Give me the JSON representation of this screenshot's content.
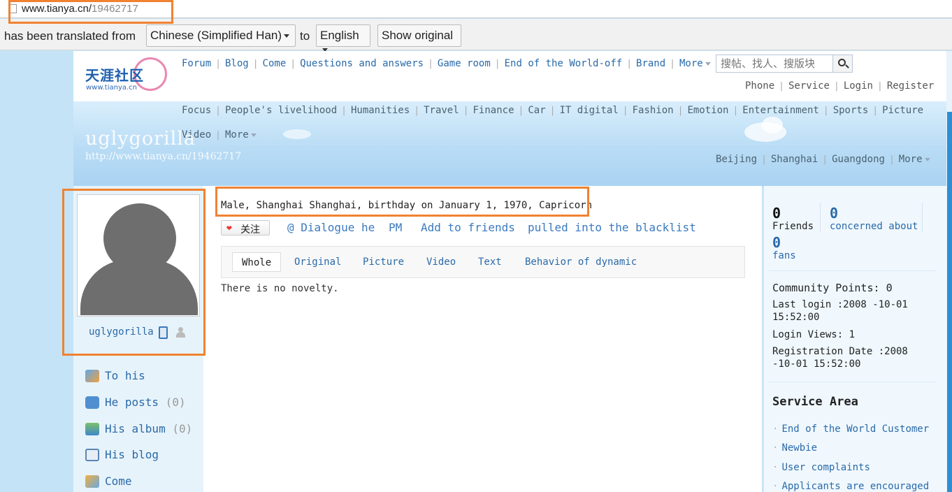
{
  "browser": {
    "url_host": "www.tianya.cn/",
    "url_path": "19462717",
    "translate": {
      "prefix": "has been translated from",
      "from_lang": "Chinese (Simplified Han)",
      "to_word": "to",
      "to_lang": "English",
      "show_original": "Show original"
    }
  },
  "header": {
    "logo_text": "天涯社区",
    "logo_sub": "www.tianya.cn",
    "nav_main": [
      "Forum",
      "Blog",
      "Come",
      "Questions and answers",
      "Game room",
      "End of the World-off",
      "Brand",
      "More"
    ],
    "search_placeholder": "搜帖、找人、搜版块",
    "nav_account": [
      "Phone",
      "Service",
      "Login",
      "Register"
    ],
    "nav_channels_row1": [
      "Focus",
      "People's livelihood",
      "Humanities",
      "Travel",
      "Finance",
      "Car",
      "IT digital",
      "Fashion",
      "Emotion",
      "Entertainment",
      "Sports",
      "Picture"
    ],
    "nav_channels_row2": [
      "Video",
      "More"
    ],
    "nav_cities": [
      "Beijing",
      "Shanghai",
      "Guangdong",
      "More"
    ]
  },
  "blog": {
    "name": "uglygorilla",
    "url": "http://www.tianya.cn/19462717"
  },
  "profile": {
    "username": "uglygorilla",
    "info_line": "Male, Shanghai Shanghai, birthday on January 1, 1970, Capricorn",
    "follow_label": "关注",
    "actions": [
      "@ Dialogue he",
      "PM",
      "Add to friends",
      "pulled into the blacklist"
    ],
    "tabs": [
      "Whole",
      "Original",
      "Picture",
      "Video",
      "Text",
      "Behavior of dynamic"
    ],
    "empty_message": "There is no novelty."
  },
  "left_menu": [
    {
      "label": "To his",
      "count": ""
    },
    {
      "label": "He posts",
      "count": "(0)"
    },
    {
      "label": "His album",
      "count": "(0)"
    },
    {
      "label": "His blog",
      "count": ""
    },
    {
      "label": "Come",
      "count": ""
    }
  ],
  "stats": {
    "friends_count": "0",
    "friends_label": "Friends",
    "concerned_count": "0",
    "concerned_label": "concerned about",
    "fans_count": "0",
    "fans_label": "fans"
  },
  "details": {
    "points_label": "Community Points:",
    "points_value": "0",
    "last_login": "Last login :2008 -10-01 15:52:00",
    "login_views_label": "Login Views:",
    "login_views_value": "1",
    "registration": "Registration Date :2008 -10-01 15:52:00"
  },
  "service": {
    "title": "Service Area",
    "items": [
      "End of the World Customer",
      "Newbie",
      "User complaints",
      "Applicants are encouraged"
    ]
  },
  "colors": {
    "highlight": "#f08232",
    "link": "#2a6aa8",
    "scroll_thumb": "#2e8ed2"
  }
}
